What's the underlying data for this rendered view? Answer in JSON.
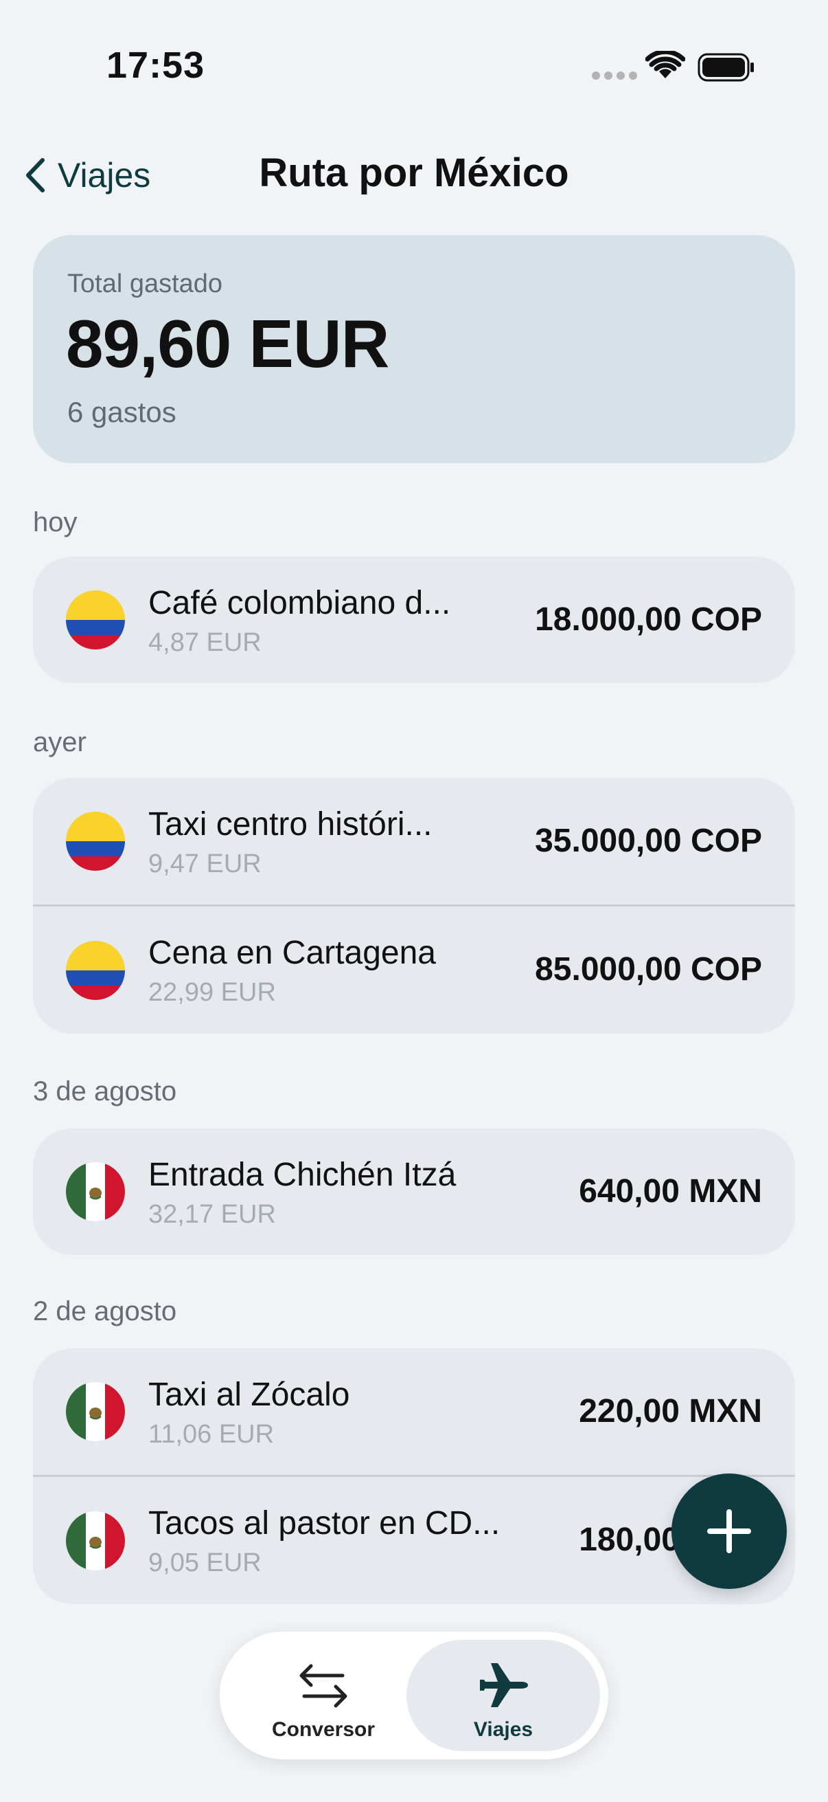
{
  "status_bar": {
    "time": "17:53"
  },
  "nav": {
    "back_label": "Viajes",
    "title": "Ruta por México"
  },
  "summary": {
    "label": "Total gastado",
    "total": "89,60 EUR",
    "count": "6 gastos"
  },
  "sections": [
    {
      "header": "hoy",
      "expenses": [
        {
          "flag": "colombia-flag-icon",
          "name": "Café colombiano d...",
          "eur": "4,87 EUR",
          "amount": "18.000,00 COP"
        }
      ]
    },
    {
      "header": "ayer",
      "expenses": [
        {
          "flag": "colombia-flag-icon",
          "name": "Taxi centro históri...",
          "eur": "9,47 EUR",
          "amount": "35.000,00 COP"
        },
        {
          "flag": "colombia-flag-icon",
          "name": "Cena en Cartagena",
          "eur": "22,99 EUR",
          "amount": "85.000,00 COP"
        }
      ]
    },
    {
      "header": "3 de agosto",
      "expenses": [
        {
          "flag": "mexico-flag-icon",
          "name": "Entrada Chichén Itzá",
          "eur": "32,17 EUR",
          "amount": "640,00 MXN"
        }
      ]
    },
    {
      "header": "2 de agosto",
      "expenses": [
        {
          "flag": "mexico-flag-icon",
          "name": "Taxi al Zócalo",
          "eur": "11,06 EUR",
          "amount": "220,00 MXN"
        },
        {
          "flag": "mexico-flag-icon",
          "name": "Tacos al pastor en CD...",
          "eur": "9,05 EUR",
          "amount": "180,00 MXN"
        }
      ]
    }
  ],
  "fab": {
    "icon": "plus-icon"
  },
  "tabs": [
    {
      "label": "Conversor",
      "icon": "swap-arrows-icon"
    },
    {
      "label": "Viajes",
      "icon": "airplane-icon",
      "selected": true
    }
  ],
  "colors": {
    "accent": "#0f3a40",
    "summary_bg": "#d6e2e7",
    "card_bg": "#e6eaee",
    "page_bg": "#f1f4f7"
  }
}
